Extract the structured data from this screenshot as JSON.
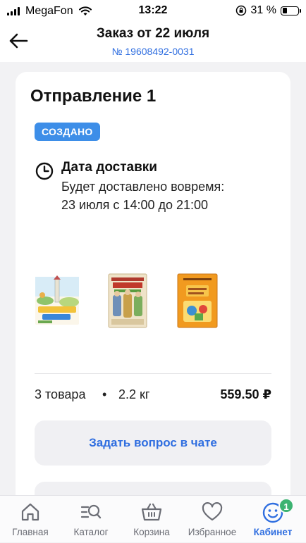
{
  "status_bar": {
    "carrier": "MegaFon",
    "time": "13:22",
    "battery": "31 %",
    "battery_level": 0.31
  },
  "header": {
    "title": "Заказ от 22 июля",
    "order_number": "№ 19608492-0031"
  },
  "shipment": {
    "title": "Отправление 1",
    "status": "СОЗДАНО",
    "delivery_title": "Дата доставки",
    "delivery_line1": "Будет доставлено вовремя:",
    "delivery_line2": "23 июля с 14:00 до 21:00",
    "items_count": "3 товара",
    "separator": "•",
    "weight": "2.2 кг",
    "price": "559.50 ₽",
    "chat_button": "Задать вопрос в чате"
  },
  "tabbar": {
    "tabs": [
      {
        "label": "Главная",
        "icon": "home-icon"
      },
      {
        "label": "Каталог",
        "icon": "catalog-search-icon"
      },
      {
        "label": "Корзина",
        "icon": "basket-icon"
      },
      {
        "label": "Избранное",
        "icon": "heart-icon"
      },
      {
        "label": "Кабинет",
        "icon": "smiley-profile-icon",
        "badge": "1",
        "active": true
      }
    ]
  },
  "colors": {
    "accent": "#2f6ee0",
    "status_badge": "#3d8ee8",
    "notification": "#3cb371"
  }
}
